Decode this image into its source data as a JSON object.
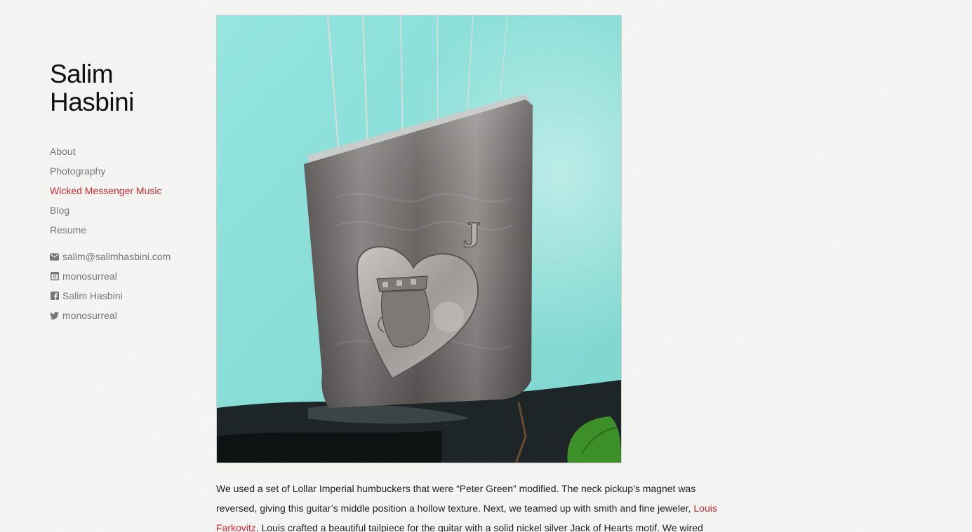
{
  "site": {
    "title_line1": "Salim",
    "title_line2": "Hasbini"
  },
  "nav": {
    "items": [
      {
        "label": "About"
      },
      {
        "label": "Photography"
      },
      {
        "label": "Wicked Messenger Music",
        "active": true
      },
      {
        "label": "Blog"
      },
      {
        "label": "Resume"
      }
    ]
  },
  "contact": {
    "email": {
      "label": "salim@salimhasbini.com",
      "icon": "envelope-icon"
    },
    "instagram": {
      "label": "monosurreal",
      "icon": "instagram-icon"
    },
    "facebook": {
      "label": "Salim Hasbini",
      "icon": "facebook-icon"
    },
    "twitter": {
      "label": "monosurreal",
      "icon": "twitter-icon"
    }
  },
  "photo": {
    "description": "Guitar tailpiece with Jack of Hearts motif on turquoise guitar body",
    "engraved_letter": "J"
  },
  "article": {
    "text_part1": "We used a set of Lollar Imperial humbuckers that were “Peter Green” modified. The neck pickup’s magnet was reversed, giving this guitar’s middle position a hollow texture. Next, we teamed up with smith and fine jeweler, ",
    "link_label": "Louis Farkovitz",
    "text_part2": ". Louis crafted a beautiful tailpiece for the guitar with a solid nickel silver Jack of Hearts motif. We wired volume"
  },
  "colors": {
    "accent": "#d0292f",
    "nav_text": "#777777",
    "body_text": "#222222",
    "background": "#f5f5f4",
    "guitar_body": "#8fe3dc"
  }
}
